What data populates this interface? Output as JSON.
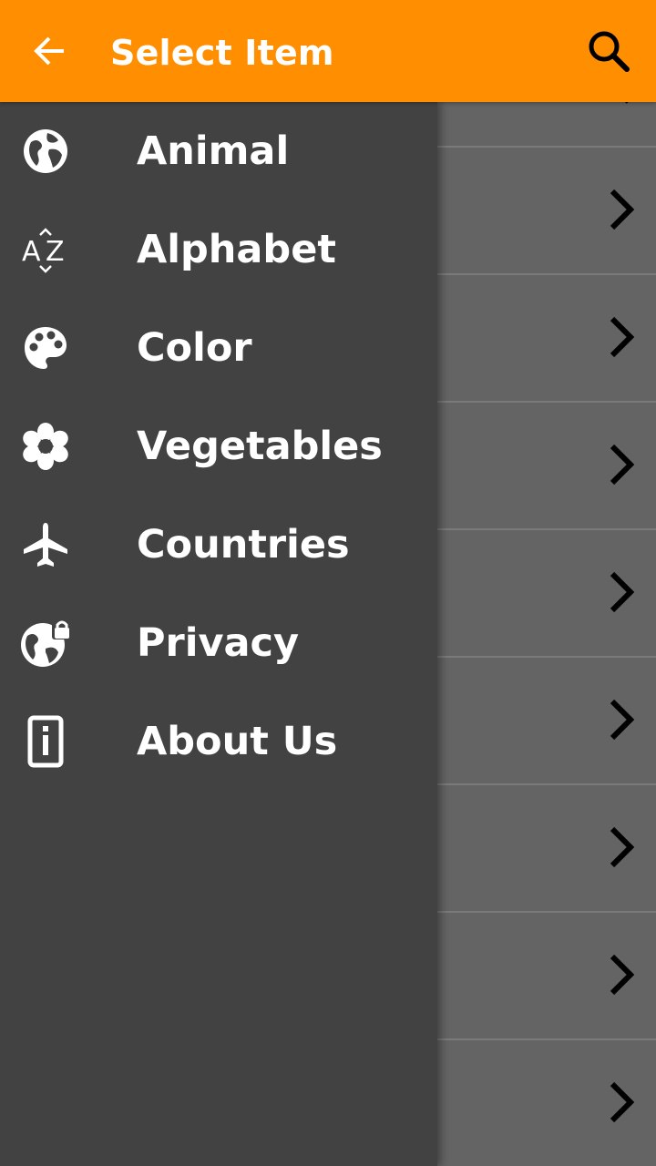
{
  "toolbar": {
    "title": "Select Item",
    "back_icon": "arrow-back-icon",
    "search_icon": "search-icon",
    "background_color": "#FF8F00"
  },
  "drawer": {
    "background_color": "#424242",
    "items": [
      {
        "label": "Animal",
        "icon": "globe-icon"
      },
      {
        "label": "Alphabet",
        "icon": "sort-az-icon"
      },
      {
        "label": "Color",
        "icon": "palette-icon"
      },
      {
        "label": "Vegetables",
        "icon": "flower-icon"
      },
      {
        "label": "Countries",
        "icon": "airplane-icon"
      },
      {
        "label": "Privacy",
        "icon": "globe-lock-icon"
      },
      {
        "label": "About Us",
        "icon": "info-device-icon"
      }
    ]
  },
  "background_list": {
    "row_icon": "chevron-right-icon",
    "row_count": 8
  }
}
